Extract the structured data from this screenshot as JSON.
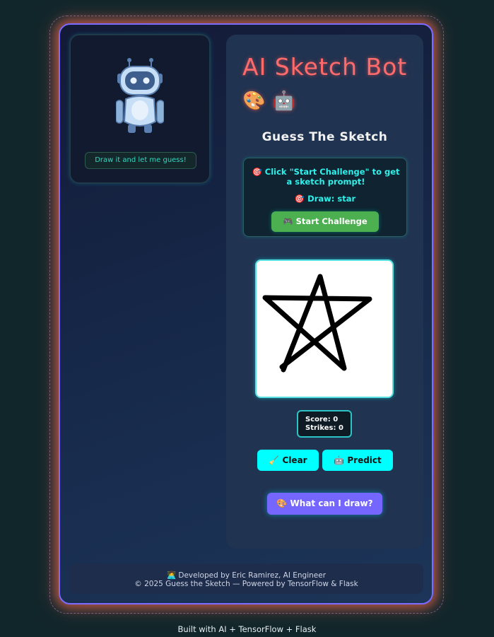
{
  "bot_panel": {
    "caption": "Draw it and let me guess!"
  },
  "main": {
    "title": "AI Sketch Bot",
    "title_emojis": "🎨 🤖",
    "subtitle": "Guess The Sketch",
    "prompt": {
      "instruction": "🎯 Click \"Start Challenge\" to get a sketch prompt!",
      "draw": "🎯 Draw: star",
      "start_button": "🎮 Start Challenge"
    },
    "score": {
      "score_text": "Score: 0",
      "strikes_text": "Strikes: 0"
    },
    "buttons": {
      "clear": "🧹 Clear",
      "predict": "🤖 Predict",
      "what_can_i_draw": "🎨 What can I draw?"
    }
  },
  "footer": {
    "developer": "👩‍💻 Developed by Eric Ramirez, AI Engineer",
    "copyright": "© 2025 Guess the Sketch — Powered by TensorFlow & Flask"
  },
  "built_with": "Built with AI + TensorFlow + Flask",
  "colors": {
    "title": "#ff6a6a",
    "accent_cyan": "#00ffff",
    "start": "#4caf50",
    "purple_button": "#7466ff"
  }
}
